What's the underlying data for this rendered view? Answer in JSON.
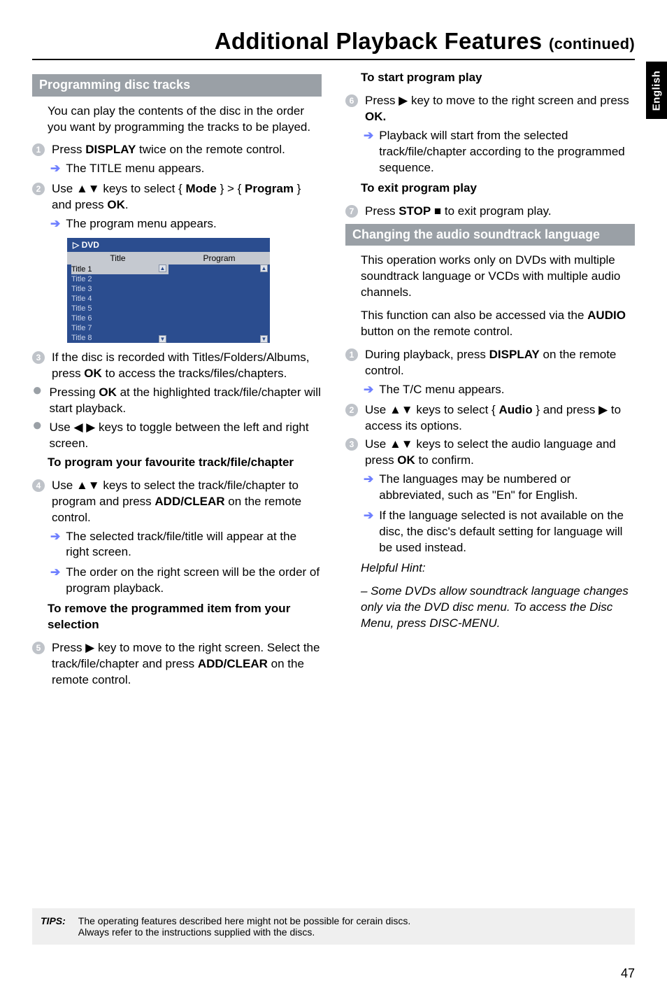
{
  "header": {
    "title_main": "Additional Playback Features",
    "title_cont": "(continued)"
  },
  "side_tab": "English",
  "left": {
    "band_programming": "Programming disc tracks",
    "intro": "You can play the contents of the disc in the order you want by programming the tracks to be played.",
    "step1": "Press DISPLAY twice on the remote control.",
    "step1_sub": "The TITLE menu appears.",
    "step2": "Use ▲▼ keys to select { Mode } > { Program } and press OK.",
    "step2_sub": "The program menu appears.",
    "menu": {
      "top": "▷  DVD",
      "col_title": "Title",
      "col_program": "Program",
      "titles": [
        "Title 1",
        "Title 2",
        "Title 3",
        "Title 4",
        "Title 5",
        "Title 6",
        "Title 7",
        "Title 8"
      ]
    },
    "step3": "If the disc is recorded with Titles/Folders/Albums, press OK to access the tracks/files/chapters.",
    "bullet_ok": "Pressing OK at the highlighted track/file/chapter will start playback.",
    "bullet_lr": "Use ◀ ▶ keys to toggle between the left and right screen.",
    "sub_fav": "To program your favourite track/file/chapter",
    "step4": "Use ▲▼ keys to select the track/file/chapter to program and press ADD/CLEAR on the remote control.",
    "step4_sub1": "The selected track/file/title will appear at the right screen.",
    "step4_sub2": "The order on the right screen will be the order of program playback.",
    "sub_remove": "To remove the programmed item from your selection",
    "step5": "Press ▶ key to move to the right screen. Select the track/file/chapter and press ADD/CLEAR on the remote control."
  },
  "right": {
    "sub_start": "To start program play",
    "step6": "Press ▶ key to move to the right screen and press OK.",
    "step6_sub": "Playback will start from the selected track/file/chapter according to the programmed sequence.",
    "sub_exit": "To exit program play",
    "step7": "Press STOP ■ to exit program play.",
    "band_audio": "Changing the audio soundtrack language",
    "audio_intro": "This operation works only on DVDs with multiple soundtrack language or VCDs with multiple audio channels.",
    "audio_note": "This function can also be accessed via the AUDIO button on the remote control.",
    "astep1": "During playback, press DISPLAY on the remote control.",
    "astep1_sub": "The T/C menu appears.",
    "astep2": "Use ▲▼ keys to select { Audio } and press ▶ to access its options.",
    "astep3": "Use ▲▼ keys to select the audio language and press OK to confirm.",
    "astep3_sub1": "The languages may be numbered or abbreviated, such as \"En\" for English.",
    "astep3_sub2": "If the language selected is not available on the disc, the disc's default setting for language will be used instead.",
    "hint_head": "Helpful Hint:",
    "hint_body": "– Some DVDs allow soundtrack language changes only via the DVD disc menu. To access the Disc Menu, press DISC-MENU."
  },
  "footer": {
    "tips_label": "TIPS:",
    "tips_text": "The operating features described here might not be possible for cerain discs.\nAlways refer to the instructions supplied with the discs."
  },
  "page_number": "47"
}
